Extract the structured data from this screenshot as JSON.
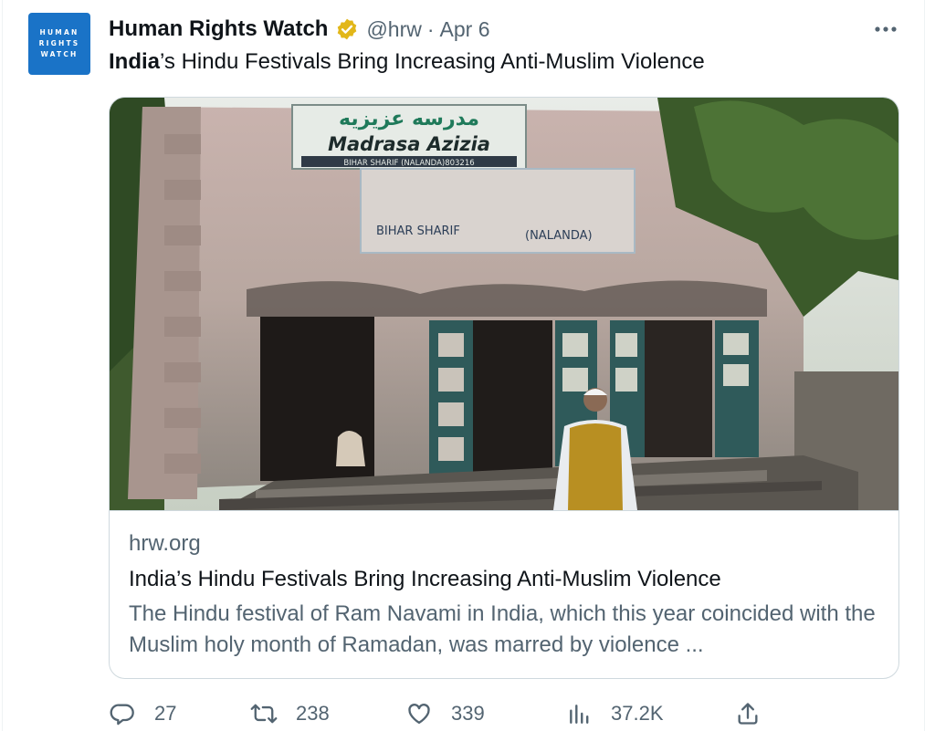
{
  "author": {
    "avatar_lines": [
      "HUMAN",
      "RIGHTS",
      "WATCH"
    ],
    "name": "Human Rights Watch",
    "handle": "@hrw",
    "separator": "·",
    "date": "Apr 6",
    "verified_icon": "gold-verified-badge"
  },
  "tweet": {
    "text_bold": "India",
    "text_rest": "’s Hindu Festivals Bring Increasing Anti-Muslim Violence"
  },
  "card": {
    "image_sign_urdu": "مدرسه عزيزيه",
    "image_sign_title": "Madrasa Azizia",
    "image_sign_sub": "BIHAR SHARIF (NALANDA)803216",
    "image_wall_left": "BIHAR SHARIF",
    "image_wall_right": "(NALANDA)",
    "domain": "hrw.org",
    "title": "India’s Hindu Festivals Bring Increasing Anti-Muslim Violence",
    "description": "The Hindu festival of Ram Navami in India, which this year coincided with the Muslim holy month of Ramadan, was marred by violence ..."
  },
  "actions": {
    "reply": {
      "icon": "reply-icon",
      "count": "27"
    },
    "retweet": {
      "icon": "retweet-icon",
      "count": "238"
    },
    "like": {
      "icon": "heart-icon",
      "count": "339"
    },
    "views": {
      "icon": "views-icon",
      "count": "37.2K"
    },
    "share": {
      "icon": "share-icon"
    }
  },
  "colors": {
    "avatar_bg": "#1a73c7",
    "secondary_text": "#536471",
    "border": "#cfd9de",
    "verified_gold": "#e2b719"
  }
}
